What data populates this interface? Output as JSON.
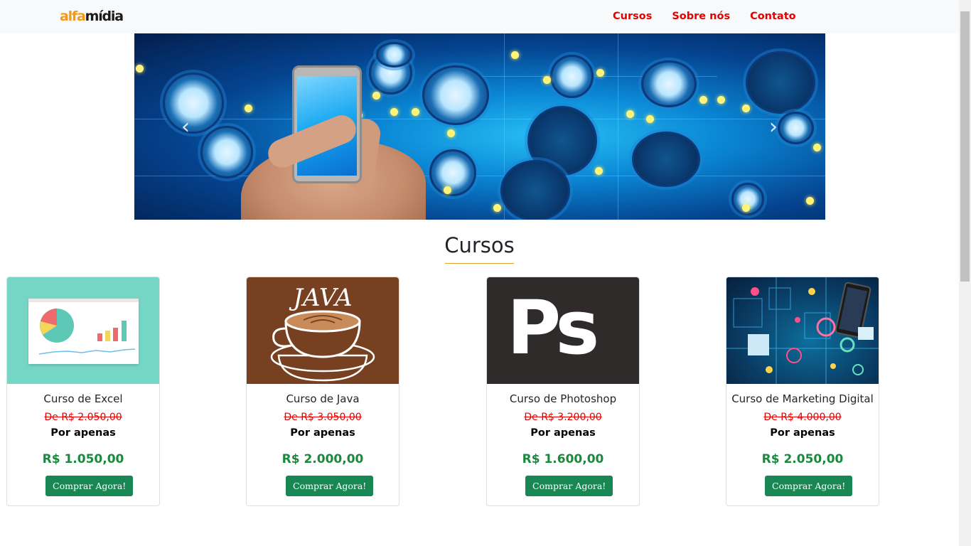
{
  "brand": {
    "part1": "alfa",
    "part2": "mídia"
  },
  "nav": {
    "items": [
      "Cursos",
      "Sobre nós",
      "Contato"
    ]
  },
  "carousel": {
    "prev_glyph": "‹",
    "next_glyph": "›"
  },
  "section": {
    "title": "Cursos"
  },
  "colors": {
    "nav_link": "#e60000",
    "old_price": "#e60000",
    "price": "#198a3c",
    "button": "#198754",
    "title_underline": "#e0a030"
  },
  "courses": [
    {
      "title": "Curso de Excel",
      "old_price": "De R$ 2.050,00",
      "subtitle": "Por apenas",
      "price": "R$ 1.050,00",
      "button": "Comprar Agora!"
    },
    {
      "title": "Curso de Java",
      "old_price": "De R$ 3.050,00",
      "subtitle": "Por apenas",
      "price": "R$ 2.000,00",
      "button": "Comprar Agora!"
    },
    {
      "title": "Curso de Photoshop",
      "old_price": "De R$ 3.200,00",
      "subtitle": "Por apenas",
      "price": "R$ 1.600,00",
      "button": "Comprar Agora!"
    },
    {
      "title": "Curso de Marketing Digital",
      "old_price": "De R$ 4.000,00",
      "subtitle": "Por apenas",
      "price": "R$ 2.050,00",
      "button": "Comprar Agora!"
    }
  ],
  "images": {
    "java_logo_text": "JAVA",
    "ps_logo_text": "Ps"
  }
}
